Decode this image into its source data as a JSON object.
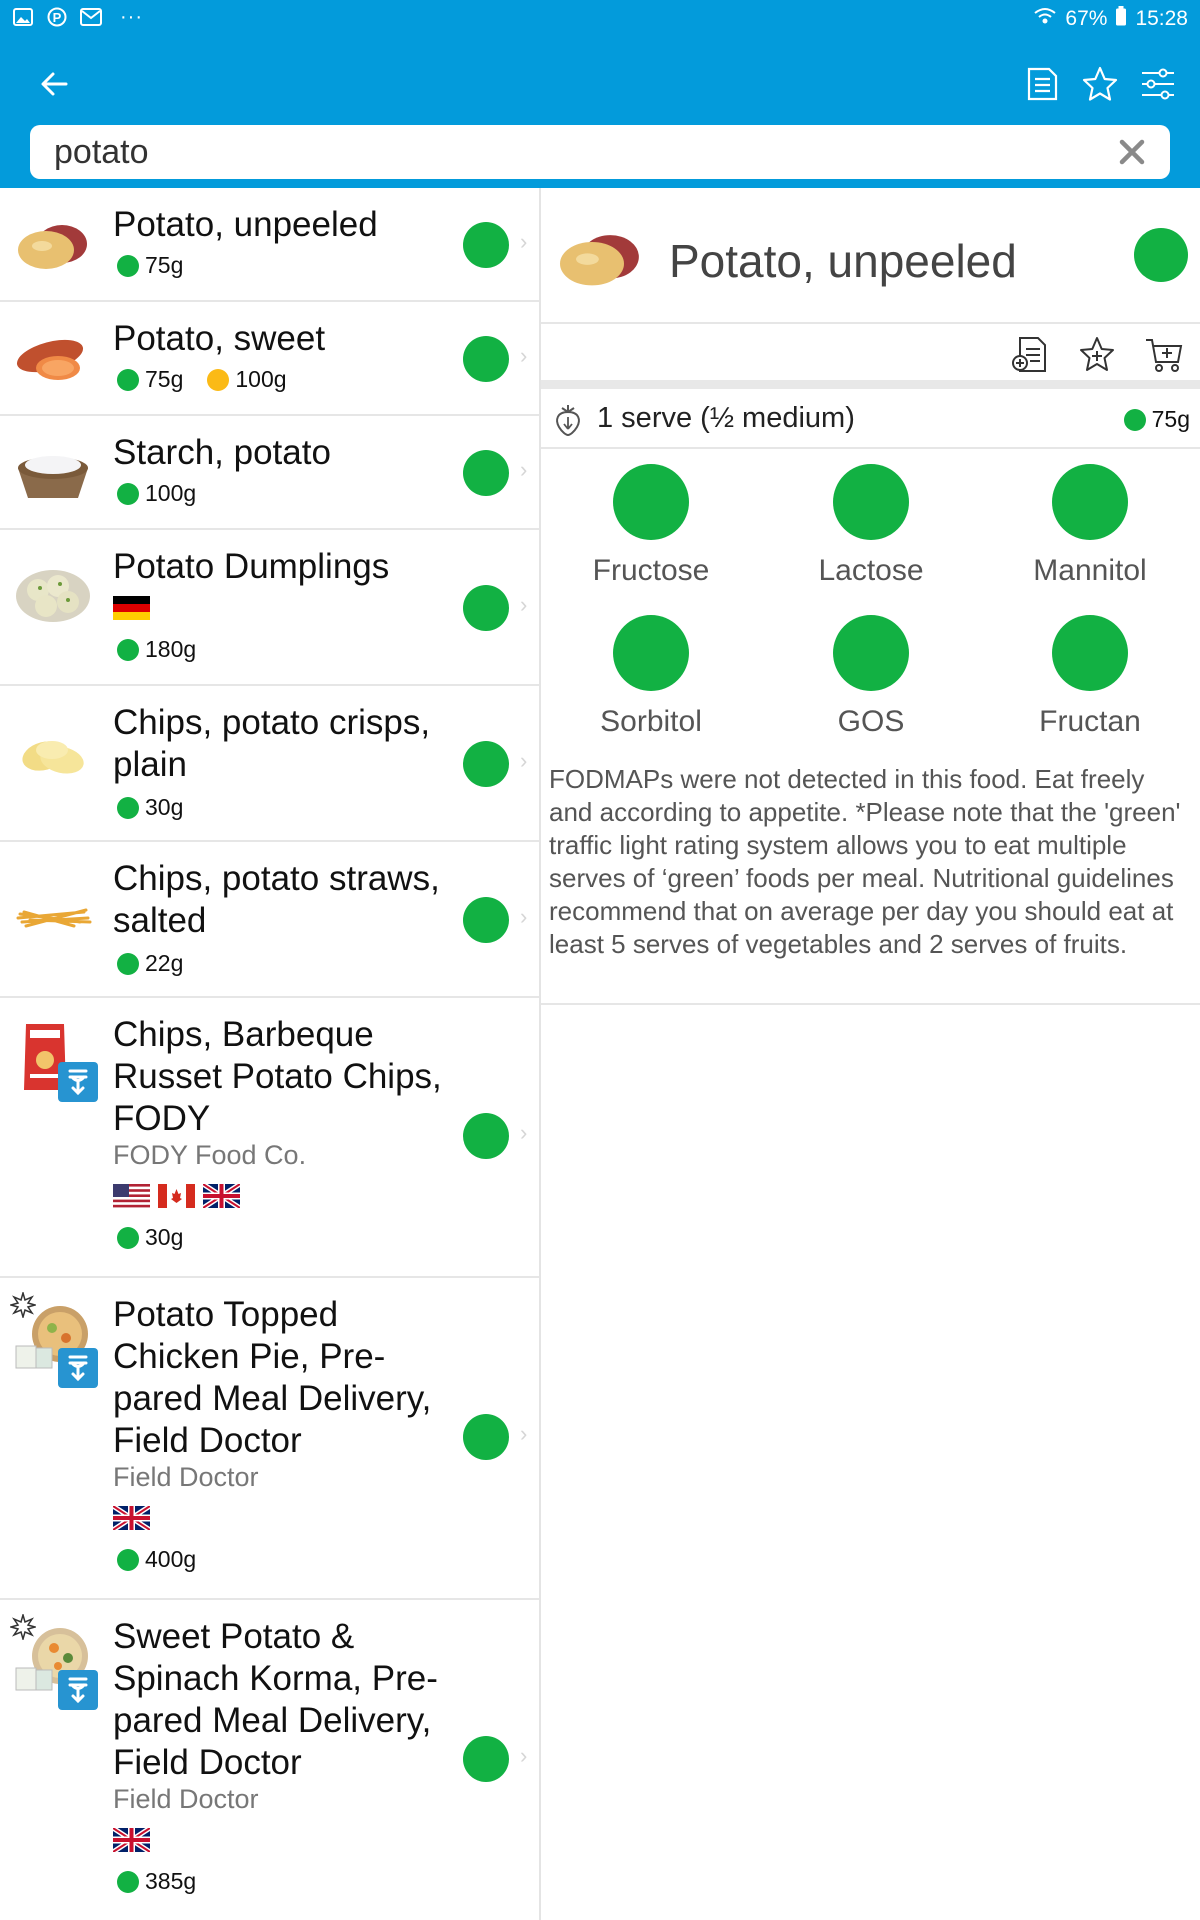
{
  "status_bar": {
    "battery": "67%",
    "time": "15:28",
    "more": "···"
  },
  "search": {
    "value": "potato",
    "placeholder": ""
  },
  "list": [
    {
      "title": "Potato, unpeeled",
      "brand": "",
      "flags": [],
      "serves": [
        {
          "color": "green",
          "amount": "75g"
        }
      ],
      "rating": "green"
    },
    {
      "title": "Potato, sweet",
      "brand": "",
      "flags": [],
      "serves": [
        {
          "color": "green",
          "amount": "75g"
        },
        {
          "color": "amber",
          "amount": "100g"
        }
      ],
      "rating": "green"
    },
    {
      "title": "Starch, potato",
      "brand": "",
      "flags": [],
      "serves": [
        {
          "color": "green",
          "amount": "100g"
        }
      ],
      "rating": "green"
    },
    {
      "title": "Potato Dumplings",
      "brand": "",
      "flags": [
        "de"
      ],
      "serves": [
        {
          "color": "green",
          "amount": "180g"
        }
      ],
      "rating": "green"
    },
    {
      "title": "Chips, potato crisps, plain",
      "brand": "",
      "flags": [],
      "serves": [
        {
          "color": "green",
          "amount": "30g"
        }
      ],
      "rating": "green"
    },
    {
      "title": "Chips, potato straws, salted",
      "brand": "",
      "flags": [],
      "serves": [
        {
          "color": "green",
          "amount": "22g"
        }
      ],
      "rating": "green"
    },
    {
      "title": "Chips, Barbeque Russet Potato Chips, FODY",
      "brand": "FODY Food Co.",
      "flags": [
        "us",
        "ca",
        "gb"
      ],
      "serves": [
        {
          "color": "green",
          "amount": "30g"
        }
      ],
      "rating": "green"
    },
    {
      "title": "Potato Topped Chicken Pie, Pre-pared Meal Delivery, Field Doctor",
      "brand": "Field Doctor",
      "flags": [
        "gb"
      ],
      "serves": [
        {
          "color": "green",
          "amount": "400g"
        }
      ],
      "rating": "green"
    },
    {
      "title": "Sweet Potato & Spinach Korma, Pre-pared Meal Delivery, Field Doctor",
      "brand": "Field Doctor",
      "flags": [
        "gb"
      ],
      "serves": [
        {
          "color": "green",
          "amount": "385g"
        }
      ],
      "rating": "green"
    }
  ],
  "detail": {
    "title": "Potato, unpeeled",
    "rating": "green",
    "serve": {
      "label": "1 serve (½ medium)",
      "amount": "75g"
    },
    "fodmaps": [
      {
        "name": "Fructose",
        "color": "green"
      },
      {
        "name": "Lactose",
        "color": "green"
      },
      {
        "name": "Mannitol",
        "color": "green"
      },
      {
        "name": "Sorbitol",
        "color": "green"
      },
      {
        "name": "GOS",
        "color": "green"
      },
      {
        "name": "Fructan",
        "color": "green"
      }
    ],
    "description": "FODMAPs were not detected in this food. Eat freely and according to appetite. *Please note that the 'green' traffic light rating system allows you to eat multiple serves of ‘green’ foods per meal. Nutritional guidelines recommend that on average per day you should eat at least 5 serves of vegetables and 2 serves of fruits."
  },
  "colors": {
    "appbar": "#039BDB",
    "green": "#12B143",
    "amber": "#FBBA16"
  },
  "icons": [
    "gallery-icon",
    "pinterest-icon",
    "mail-icon",
    "wifi-icon",
    "battery-icon",
    "back-arrow-icon",
    "notes-icon",
    "star-icon",
    "filter-icon",
    "clear-icon",
    "add-note-icon",
    "add-favourite-icon",
    "add-to-cart-icon",
    "serve-strawberry-icon",
    "chevron-right-icon",
    "gut-badge-icon",
    "new-badge-icon"
  ]
}
